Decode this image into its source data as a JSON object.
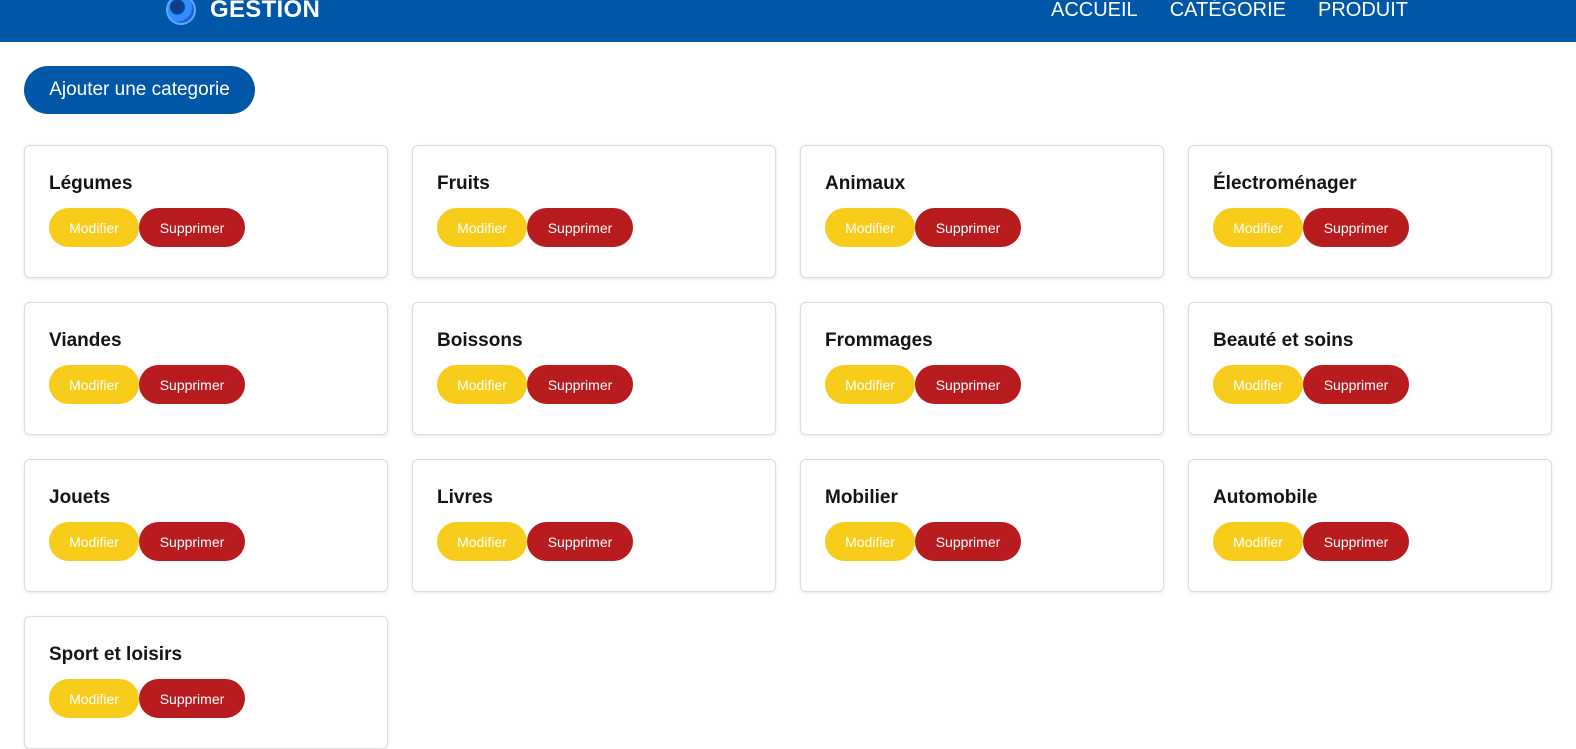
{
  "header": {
    "brand": "GESTION",
    "logo_icon": "swirl-logo-icon",
    "nav": [
      {
        "label": "ACCUEIL"
      },
      {
        "label": "CATÉGORIE"
      },
      {
        "label": "PRODUIT"
      }
    ],
    "bg_color": "#0056a7"
  },
  "main": {
    "add_button_label": "Ajouter une categorie",
    "edit_label": "Modifier",
    "delete_label": "Supprimer",
    "categories": [
      {
        "name": "Légumes"
      },
      {
        "name": "Fruits"
      },
      {
        "name": "Animaux"
      },
      {
        "name": "Électroménager"
      },
      {
        "name": "Viandes"
      },
      {
        "name": "Boissons"
      },
      {
        "name": "Frommages"
      },
      {
        "name": "Beauté et soins"
      },
      {
        "name": "Jouets"
      },
      {
        "name": "Livres"
      },
      {
        "name": "Mobilier"
      },
      {
        "name": "Automobile"
      },
      {
        "name": "Sport et loisirs"
      }
    ]
  },
  "colors": {
    "primary": "#0056a7",
    "edit": "#f8cc1b",
    "delete": "#b81c1f"
  }
}
